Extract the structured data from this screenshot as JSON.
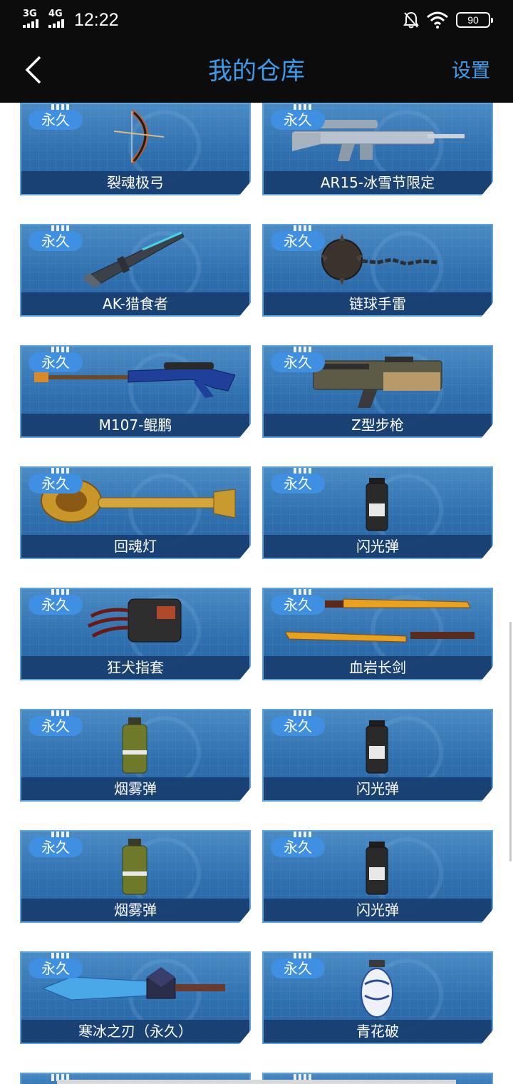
{
  "status_bar": {
    "signal1_label": "3G",
    "signal2_label": "4G",
    "time": "12:22",
    "battery": "90"
  },
  "header": {
    "title": "我的仓库",
    "settings_label": "设置"
  },
  "items": [
    {
      "badge": "永久",
      "name": "裂魂极弓",
      "icon": "bow-icon"
    },
    {
      "badge": "永久",
      "name": "AR15-冰雪节限定",
      "icon": "rifle-icon"
    },
    {
      "badge": "永久",
      "name": "AK-猎食者",
      "icon": "rifle-icon"
    },
    {
      "badge": "永久",
      "name": "链球手雷",
      "icon": "flail-icon"
    },
    {
      "badge": "永久",
      "name": "M107-鲲鹏",
      "icon": "sniper-rifle-icon"
    },
    {
      "badge": "永久",
      "name": "Z型步枪",
      "icon": "rifle-icon"
    },
    {
      "badge": "永久",
      "name": "回魂灯",
      "icon": "mace-icon"
    },
    {
      "badge": "永久",
      "name": "闪光弹",
      "icon": "flashbang-icon"
    },
    {
      "badge": "永久",
      "name": "狂犬指套",
      "icon": "claw-icon"
    },
    {
      "badge": "永久",
      "name": "血岩长剑",
      "icon": "katana-icon"
    },
    {
      "badge": "永久",
      "name": "烟雾弹",
      "icon": "smoke-grenade-icon"
    },
    {
      "badge": "永久",
      "name": "闪光弹",
      "icon": "flashbang-icon"
    },
    {
      "badge": "永久",
      "name": "烟雾弹",
      "icon": "smoke-grenade-icon"
    },
    {
      "badge": "永久",
      "name": "闪光弹",
      "icon": "flashbang-icon"
    },
    {
      "badge": "永久",
      "name": "寒冰之刃（永久）",
      "icon": "sword-icon"
    },
    {
      "badge": "永久",
      "name": "青花破",
      "icon": "porcelain-grenade-icon"
    }
  ],
  "colors": {
    "accent": "#3d9be9",
    "card_blue": "#2e6fae",
    "badge_blue": "#3f8fe3"
  }
}
